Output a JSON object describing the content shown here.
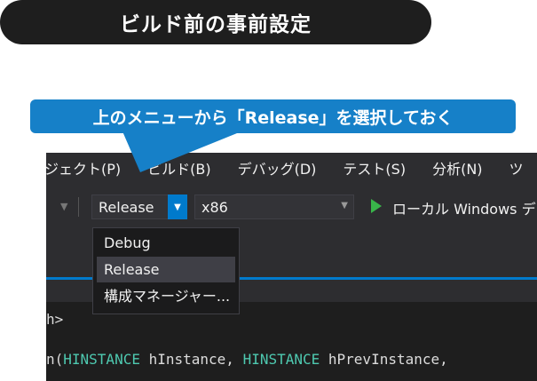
{
  "title": "ビルド前の事前設定",
  "callout": "上のメニューから「Release」を選択しておく",
  "menu": [
    "ジェクト(P)",
    "ビルド(B)",
    "デバッグ(D)",
    "テスト(S)",
    "分析(N)",
    "ツ"
  ],
  "toolbar": {
    "configuration": "Release",
    "platform": "x86",
    "run_label": "ローカル Windows デ"
  },
  "dropdown": {
    "items": [
      "Debug",
      "Release",
      "構成マネージャー..."
    ],
    "selected": "Release"
  },
  "code": {
    "line1": "h>",
    "line2_prefix": "n(",
    "line2_type1": "HINSTANCE",
    "line2_mid": " hInstance, ",
    "line2_type2": "HINSTANCE",
    "line2_suffix": " hPrevInstance, "
  },
  "colors": {
    "accent": "#007acc",
    "callout": "#1680c8",
    "title_bg": "#1e1e1e",
    "run_green": "#39b54a"
  }
}
